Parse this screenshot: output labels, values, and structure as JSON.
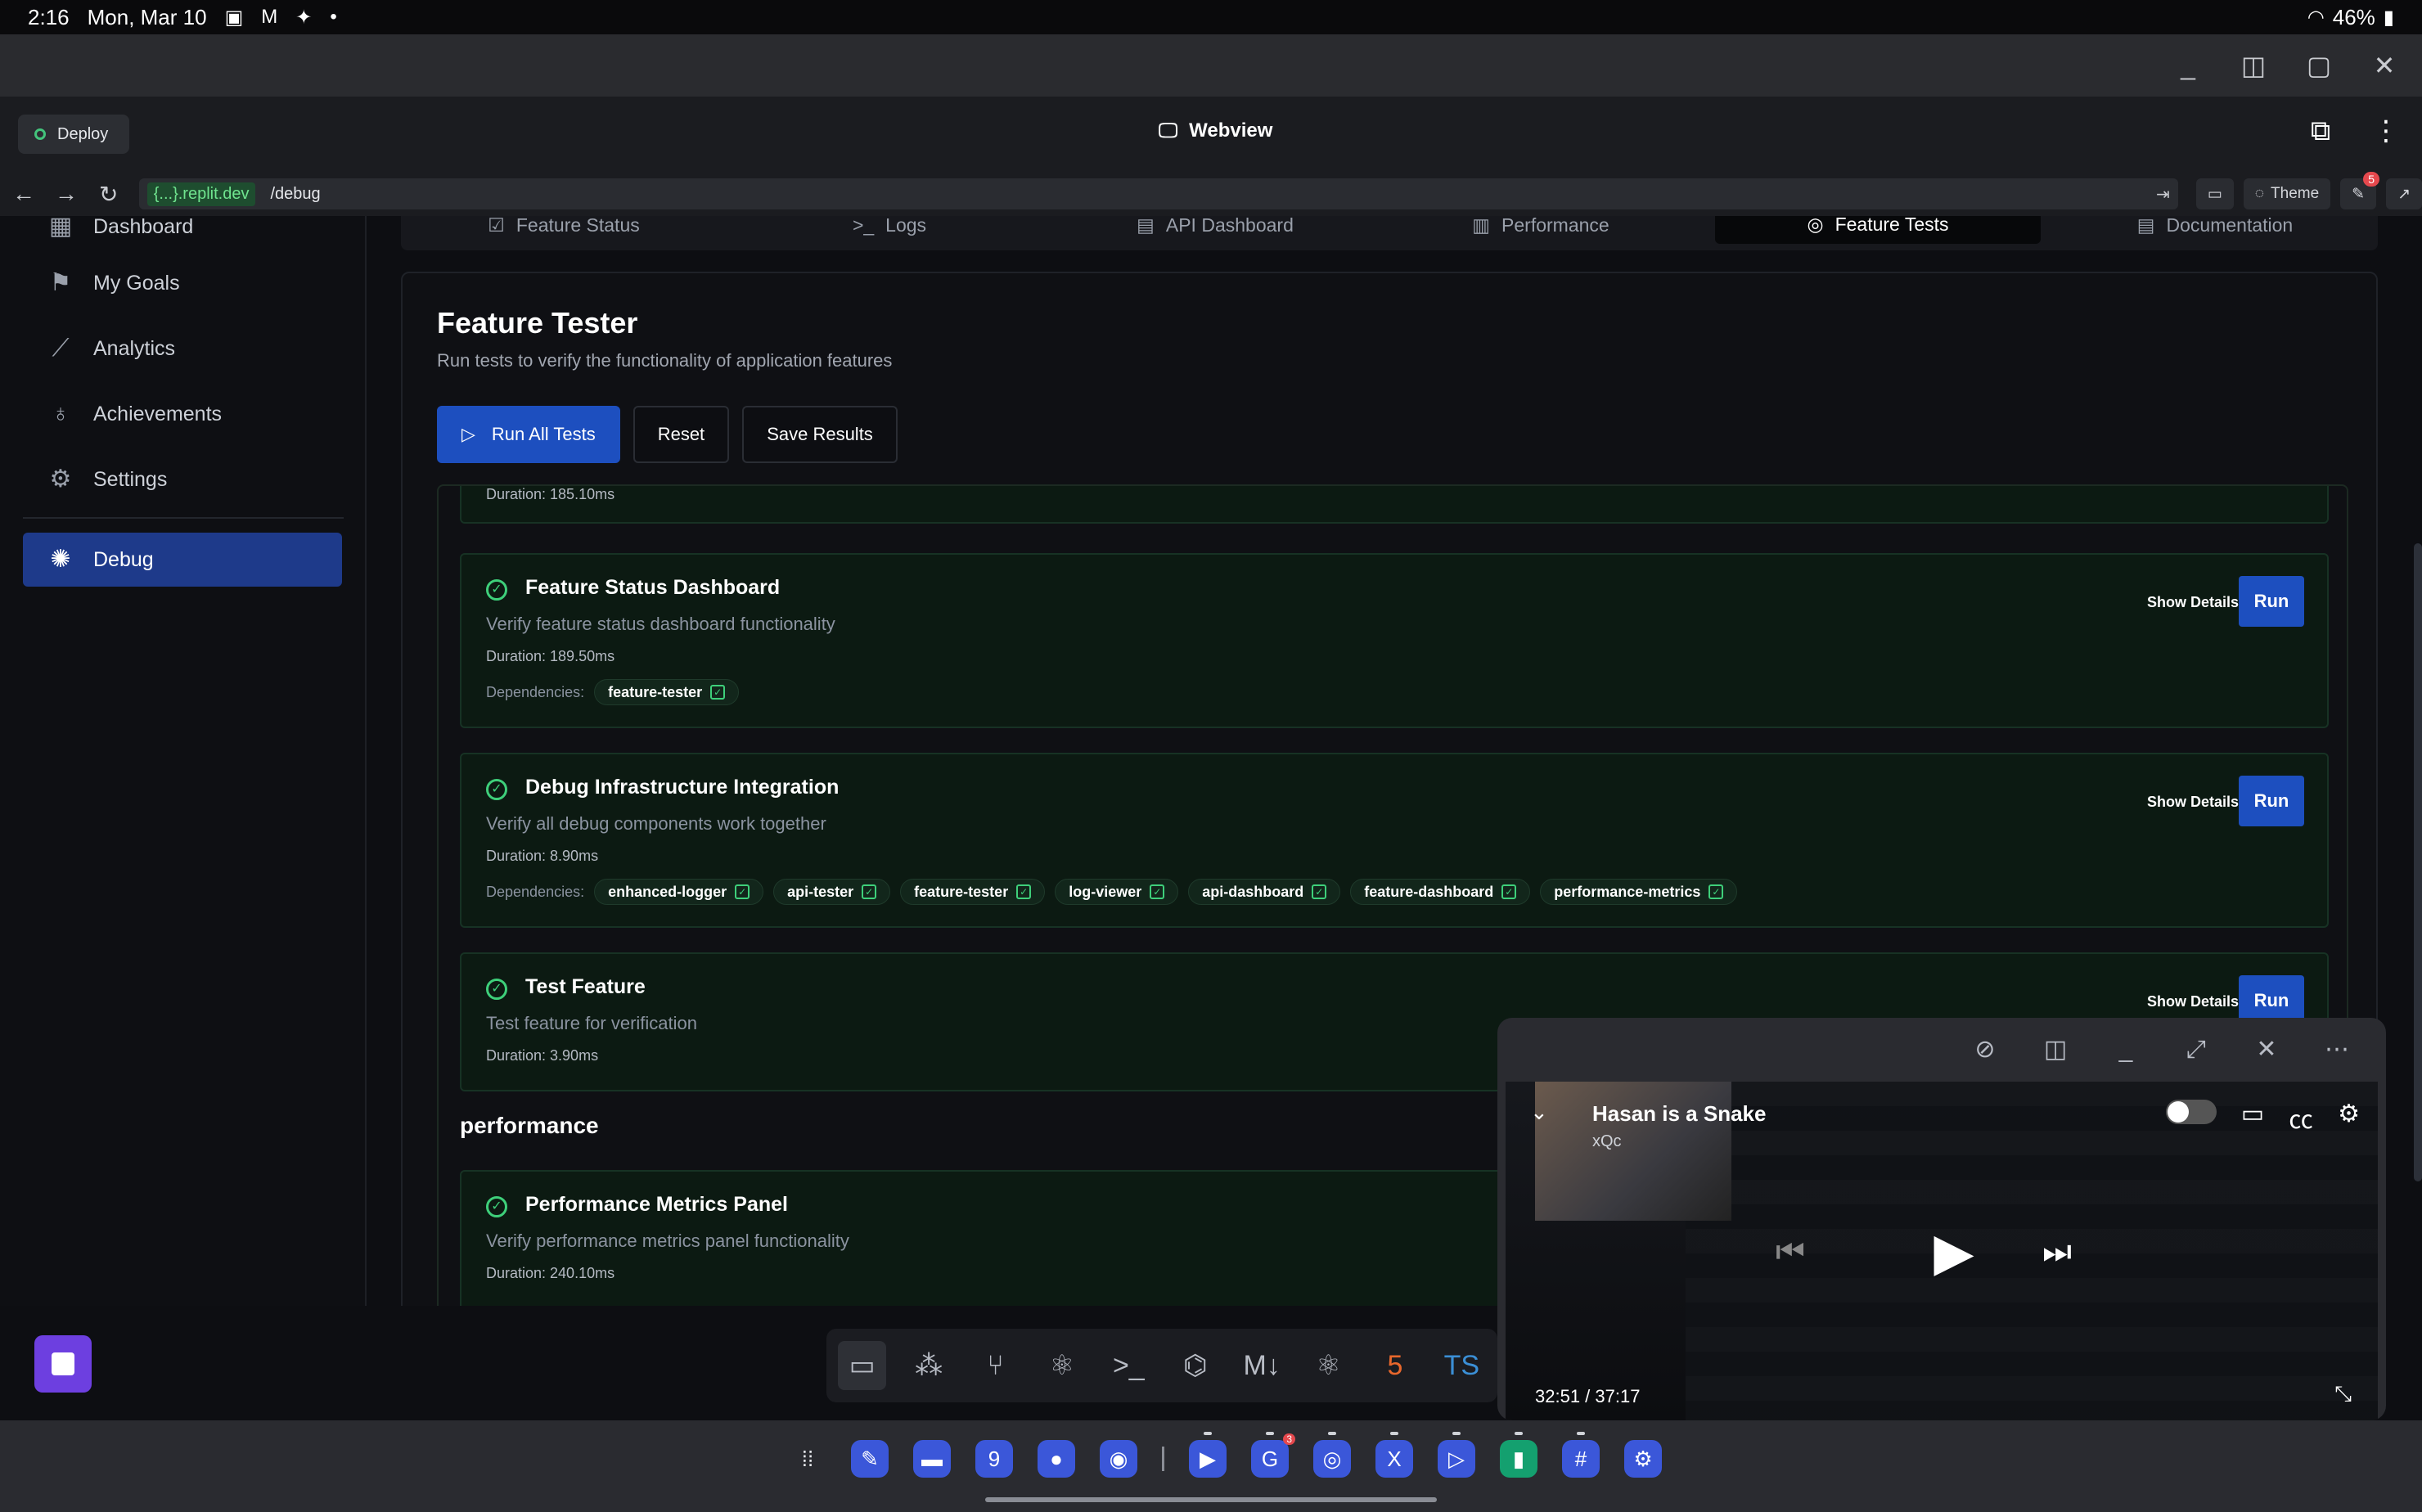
{
  "status_bar": {
    "time": "2:16",
    "date": "Mon, Mar 10",
    "battery": "46%"
  },
  "app_header": {
    "deploy_label": "Deploy",
    "title": "Webview",
    "theme_label": "Theme",
    "notif_count": "5"
  },
  "url_bar": {
    "host": "{...}.replit.dev",
    "path": "/debug"
  },
  "sidebar": {
    "items": [
      {
        "label": "Dashboard"
      },
      {
        "label": "My Goals"
      },
      {
        "label": "Analytics"
      },
      {
        "label": "Achievements"
      },
      {
        "label": "Settings"
      },
      {
        "label": "Debug"
      }
    ]
  },
  "tabs": [
    {
      "label": "Feature Status"
    },
    {
      "label": "Logs"
    },
    {
      "label": "API Dashboard"
    },
    {
      "label": "Performance"
    },
    {
      "label": "Feature Tests"
    },
    {
      "label": "Documentation"
    }
  ],
  "panel": {
    "title": "Feature Tester",
    "subtitle": "Run tests to verify the functionality of application features",
    "run_all": "Run All Tests",
    "reset": "Reset",
    "save": "Save Results"
  },
  "cards": {
    "top_duration": "Duration: 185.10ms",
    "c1": {
      "name": "Feature Status Dashboard",
      "desc": "Verify feature status dashboard functionality",
      "duration": "Duration: 189.50ms",
      "deps_label": "Dependencies:",
      "deps": [
        "feature-tester"
      ]
    },
    "c2": {
      "name": "Debug Infrastructure Integration",
      "desc": "Verify all debug components work together",
      "duration": "Duration: 8.90ms",
      "deps_label": "Dependencies:",
      "deps": [
        "enhanced-logger",
        "api-tester",
        "feature-tester",
        "log-viewer",
        "api-dashboard",
        "feature-dashboard",
        "performance-metrics"
      ]
    },
    "c3": {
      "name": "Test Feature",
      "desc": "Test feature for verification",
      "duration": "Duration: 3.90ms"
    },
    "section": "performance",
    "c4": {
      "name": "Performance Metrics Panel",
      "desc": "Verify performance metrics panel functionality",
      "duration": "Duration: 240.10ms"
    },
    "show_details": "Show Details",
    "run": "Run"
  },
  "pip": {
    "title": "Hasan is a Snake",
    "channel": "xQc",
    "time": "32:51 / 37:17"
  }
}
